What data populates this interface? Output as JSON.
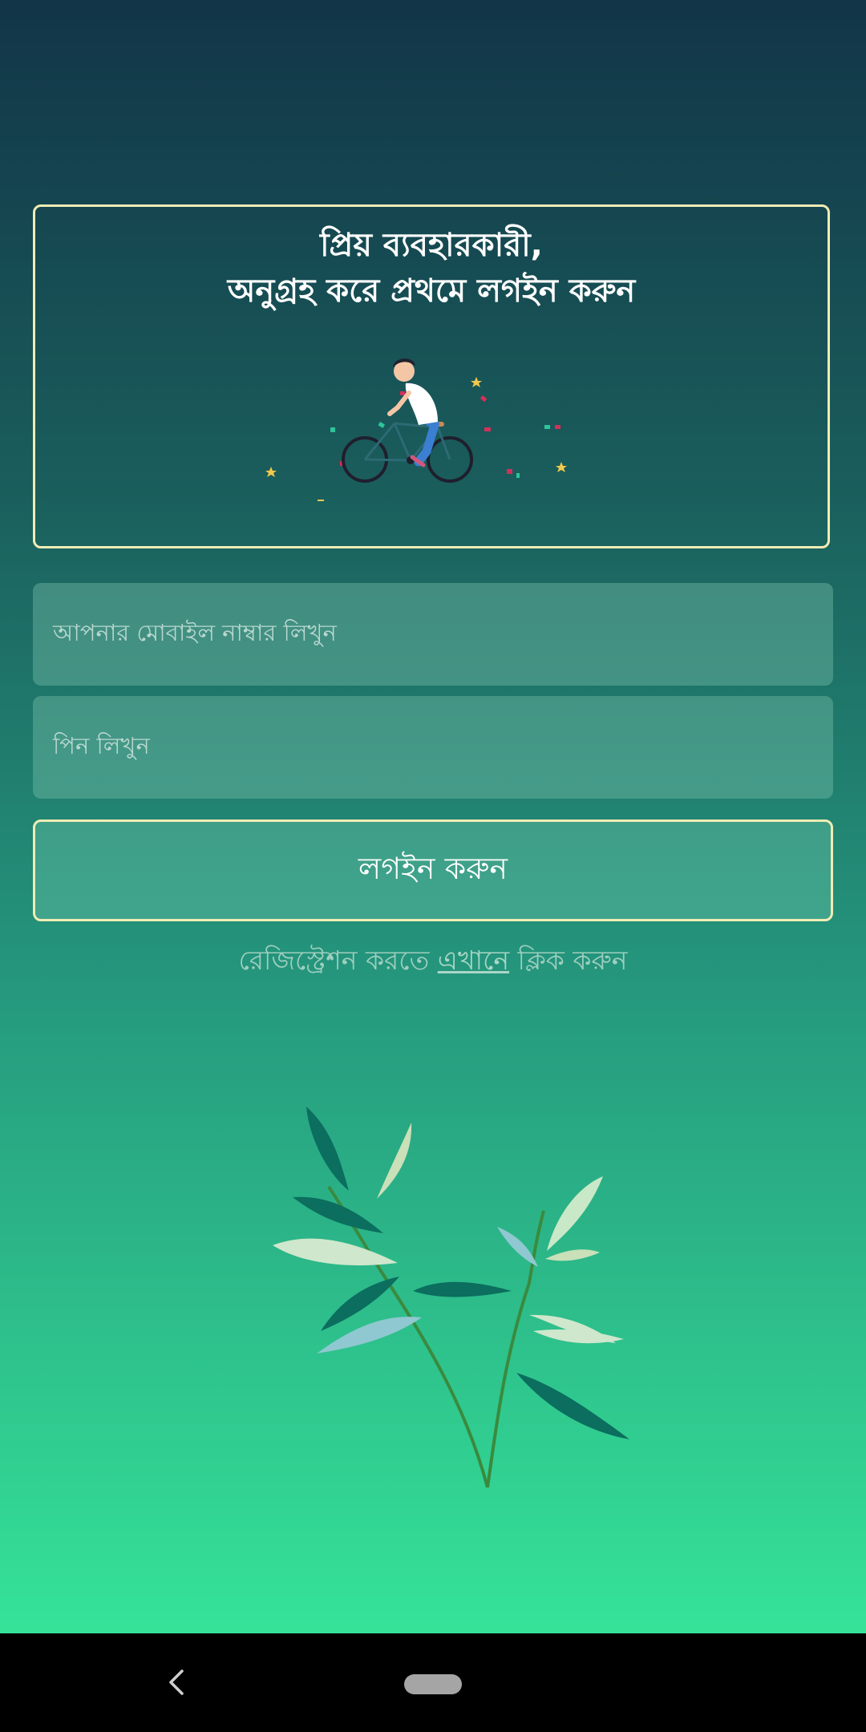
{
  "welcome": {
    "line1": "প্রিয় ব্যবহারকারী,",
    "line2": "অনুগ্রহ করে প্রথমে লগইন করুন"
  },
  "mobile": {
    "placeholder": "আপনার মোবাইল নাম্বার লিখুন"
  },
  "pin": {
    "placeholder": "পিন লিখুন"
  },
  "login_button": {
    "label": "লগইন করুন"
  },
  "register": {
    "prefix": "রেজিস্ট্রেশন করতে ",
    "link": "এখানে",
    "suffix": " ক্লিক করুন"
  },
  "icons": {
    "illustration": "cyclist-illustration",
    "plant": "plant-illustration",
    "back": "back-icon",
    "home": "home-pill"
  },
  "colors": {
    "card_border": "#f1ecb4",
    "gradient_top": "#123548",
    "gradient_bottom": "#35e398"
  }
}
